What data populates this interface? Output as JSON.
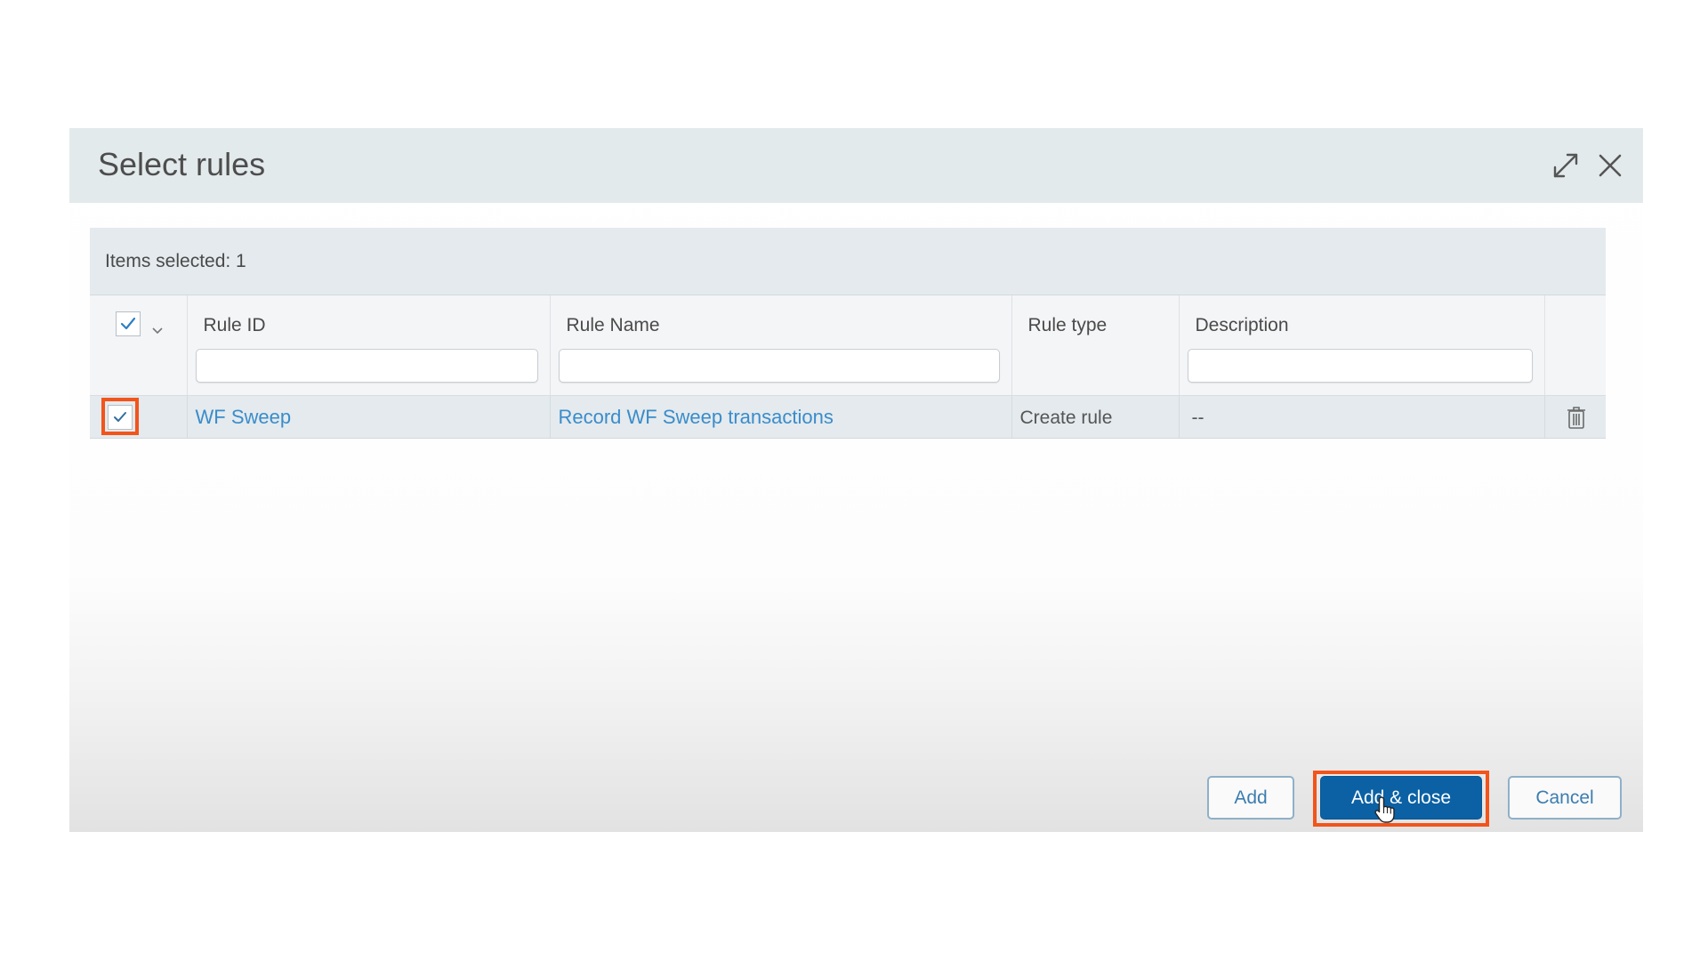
{
  "dialog": {
    "title": "Select rules",
    "expand_icon": "expand-arrows-icon",
    "close_icon": "close-x-icon"
  },
  "selection": {
    "label": "Items selected: 1"
  },
  "table": {
    "select_all_checked": true,
    "columns": [
      {
        "label": "Rule ID",
        "has_filter": true,
        "filter_value": ""
      },
      {
        "label": "Rule Name",
        "has_filter": true,
        "filter_value": ""
      },
      {
        "label": "Rule type",
        "has_filter": false
      },
      {
        "label": "Description",
        "has_filter": true,
        "filter_value": ""
      }
    ],
    "rows": [
      {
        "checked": true,
        "rule_id": "WF Sweep",
        "rule_name": "Record WF Sweep transactions",
        "rule_type": "Create rule",
        "description": "--",
        "action_icon": "trash-icon"
      }
    ]
  },
  "footer": {
    "add_label": "Add",
    "add_close_label": "Add & close",
    "cancel_label": "Cancel"
  },
  "colors": {
    "primary": "#0b61a4",
    "link": "#3a8ccb",
    "highlight": "#f2541b",
    "header_bg": "#e3eaec"
  }
}
